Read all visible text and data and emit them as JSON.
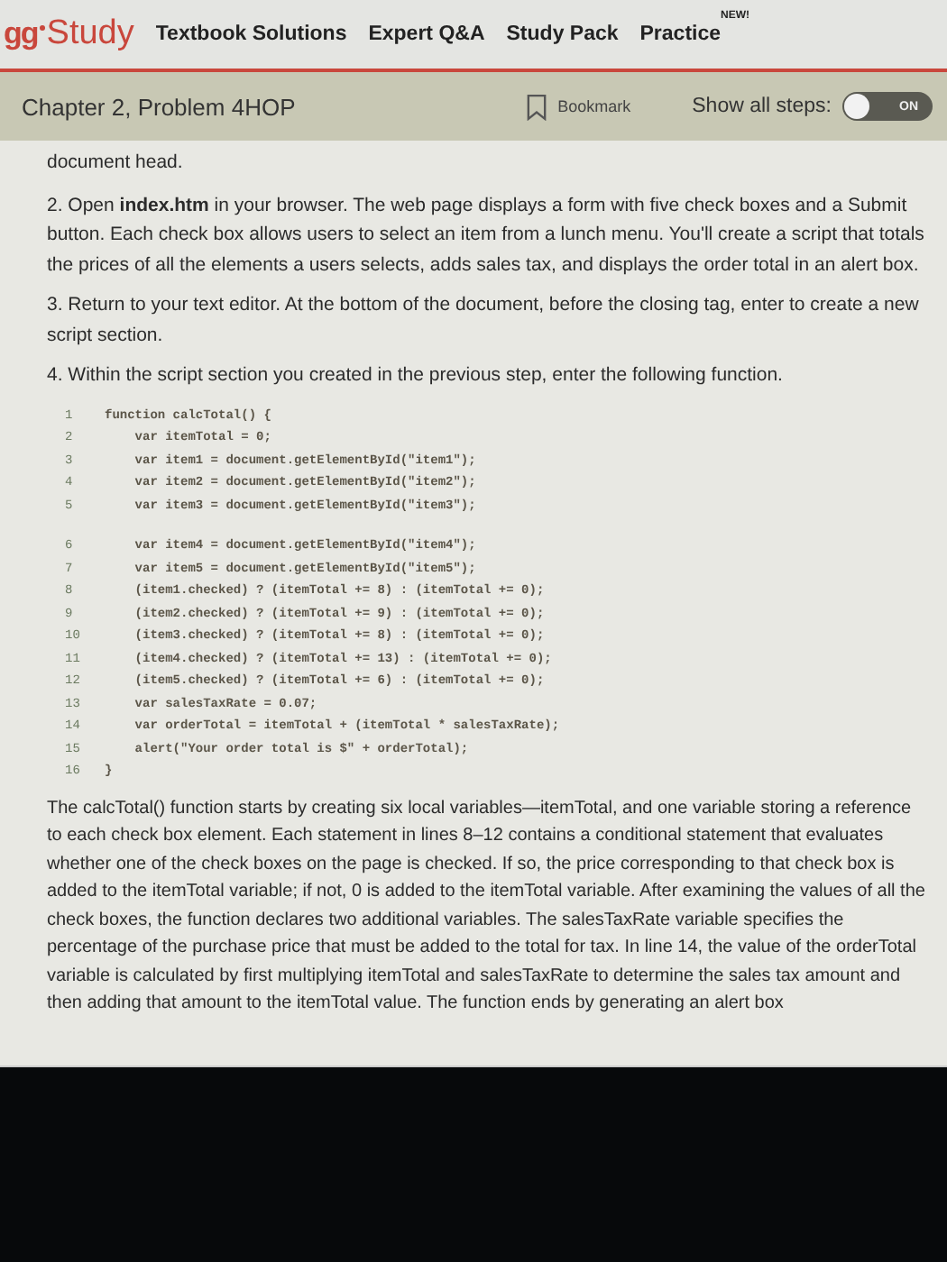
{
  "header": {
    "logo_mark": "gg",
    "logo_text": "Study",
    "nav": [
      {
        "label": "Textbook Solutions"
      },
      {
        "label": "Expert Q&A"
      },
      {
        "label": "Study Pack"
      },
      {
        "label": "Practice",
        "badge": "NEW!"
      }
    ]
  },
  "problem_bar": {
    "title": "Chapter 2, Problem 4HOP",
    "bookmark": "Bookmark",
    "show_steps_label": "Show all steps:",
    "toggle": {
      "label": "ON",
      "on": true
    }
  },
  "content": {
    "intro_tail": "document head.",
    "steps": [
      "2. Open **index.htm** in your browser. The web page displays a form with five check boxes and a Submit button. Each check box allows users to select an item from a lunch menu. You'll create a script that totals the prices of all the elements a users selects, adds sales tax, and displays the order total in an alert box.",
      "3. Return to your text editor. At the bottom of the document, before the closing tag, enter to create a new script section.",
      "4. Within the script section you created in the previous step, enter the following function."
    ],
    "code_blocks": [
      [
        {
          "number": "1",
          "text": "function calcTotal() {"
        },
        {
          "number": "2",
          "text": "    var itemTotal = 0;"
        },
        {
          "number": "3",
          "text": "    var item1 = document.getElementById(\"item1\");"
        },
        {
          "number": "4",
          "text": "    var item2 = document.getElementById(\"item2\");"
        },
        {
          "number": "5",
          "text": "    var item3 = document.getElementById(\"item3\");"
        }
      ],
      [
        {
          "number": "6",
          "text": "    var item4 = document.getElementById(\"item4\");"
        },
        {
          "number": "7",
          "text": "    var item5 = document.getElementById(\"item5\");"
        },
        {
          "number": "8",
          "text": "    (item1.checked) ? (itemTotal += 8) : (itemTotal += 0);"
        },
        {
          "number": "9",
          "text": "    (item2.checked) ? (itemTotal += 9) : (itemTotal += 0);"
        },
        {
          "number": "10",
          "text": "    (item3.checked) ? (itemTotal += 8) : (itemTotal += 0);"
        },
        {
          "number": "11",
          "text": "    (item4.checked) ? (itemTotal += 13) : (itemTotal += 0);"
        },
        {
          "number": "12",
          "text": "    (item5.checked) ? (itemTotal += 6) : (itemTotal += 0);"
        },
        {
          "number": "13",
          "text": "    var salesTaxRate = 0.07;"
        },
        {
          "number": "14",
          "text": "    var orderTotal = itemTotal + (itemTotal * salesTaxRate);"
        },
        {
          "number": "15",
          "text": "    alert(\"Your order total is $\" + orderTotal);"
        },
        {
          "number": "16",
          "text": "}"
        }
      ]
    ],
    "explanation": "The calcTotal() function starts by creating six local variables—itemTotal, and one variable storing a reference to each check box element. Each statement in lines 8–12 contains a conditional statement that evaluates whether one of the check boxes on the page is checked. If so, the price corresponding to that check box is added to the itemTotal variable; if not, 0 is added to the itemTotal variable. After examining the values of all the check boxes, the function declares two additional variables. The salesTaxRate variable specifies the percentage of the purchase price that must be added to the total for tax. In line 14, the value of the orderTotal variable is calculated by first multiplying itemTotal and salesTaxRate to determine the sales tax amount and then adding that amount to the itemTotal value. The function ends by generating an alert box"
  }
}
